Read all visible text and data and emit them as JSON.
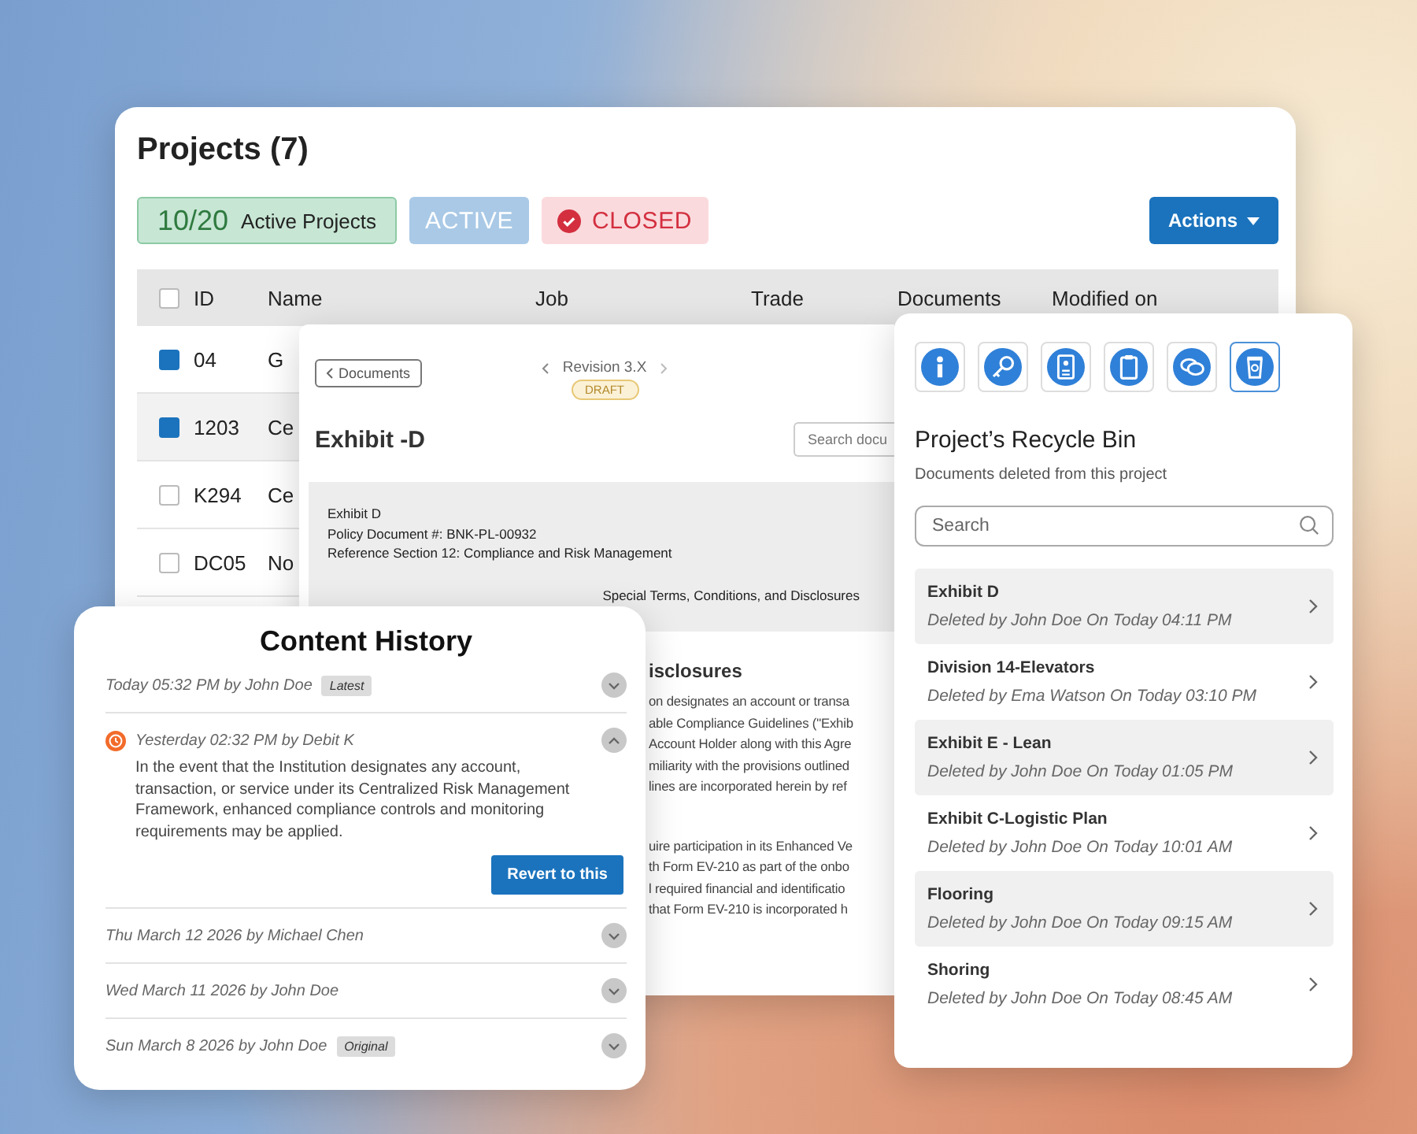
{
  "projects": {
    "title": "Projects (7)",
    "summary": {
      "count": "10/20",
      "label": "Active Projects"
    },
    "filters": [
      {
        "label": "ACTIVE",
        "kind": "active",
        "selected": false
      },
      {
        "label": "CLOSED",
        "kind": "closed",
        "selected": true
      }
    ],
    "actions": "Actions",
    "header_checked": false,
    "columns": [
      "ID",
      "Name",
      "Job",
      "Trade",
      "Documents",
      "Modified on"
    ],
    "rows": [
      {
        "id": "04",
        "name": "G",
        "checked": true,
        "hovered": false
      },
      {
        "id": "1203",
        "name": "Ce",
        "checked": true,
        "hovered": true
      },
      {
        "id": "K294",
        "name": "Ce",
        "checked": false,
        "hovered": false
      },
      {
        "id": "DC05",
        "name": "No",
        "checked": false,
        "hovered": false
      }
    ]
  },
  "document": {
    "back": "Documents",
    "revision": "Revision 3.X",
    "status": "DRAFT",
    "title": "Exhibit -D",
    "search": {
      "placeholder": "Search docu"
    },
    "header_lines": [
      "Exhibit D",
      "Policy Document #: BNK-PL-00932",
      "Reference Section 12: Compliance and Risk Management"
    ],
    "section_title": "Special Terms, Conditions, and Disclosures",
    "heading": "isclosures",
    "paragraphs": [
      [
        "on designates an account or transa",
        "able Compliance Guidelines (\"Exhib",
        "Account Holder along with this Agre",
        "miliarity with the provisions outlined",
        "lines are incorporated herein by ref"
      ],
      [
        "uire participation in its Enhanced Ve",
        "th Form EV-210 as part of the onbo",
        "l required financial and identificatio",
        "that Form EV-210 is incorporated h"
      ]
    ]
  },
  "recycle_bin": {
    "tools": [
      {
        "kind": "info",
        "selected": false
      },
      {
        "kind": "key",
        "selected": false
      },
      {
        "kind": "id-card",
        "selected": false
      },
      {
        "kind": "clipboard",
        "selected": false
      },
      {
        "kind": "chat",
        "selected": false
      },
      {
        "kind": "recycle",
        "selected": true
      }
    ],
    "title": "Project’s Recycle Bin",
    "subtitle": "Documents deleted from this project",
    "search": {
      "placeholder": "Search"
    },
    "items": [
      {
        "name": "Exhibit D",
        "detail": "Deleted by John Doe On Today 04:11 PM"
      },
      {
        "name": "Division 14-Elevators",
        "detail": "Deleted by Ema Watson On Today 03:10 PM"
      },
      {
        "name": "Exhibit E - Lean",
        "detail": "Deleted by John Doe On Today 01:05 PM"
      },
      {
        "name": "Exhibit C-Logistic Plan",
        "detail": "Deleted by John Doe On Today 10:01 AM"
      },
      {
        "name": "Flooring",
        "detail": "Deleted by John Doe On Today 09:15 AM"
      },
      {
        "name": "Shoring",
        "detail": "Deleted by John Doe On Today 08:45 AM"
      }
    ]
  },
  "content_history": {
    "title": "Content History",
    "entries": [
      {
        "meta": "Today 05:32 PM by John Doe",
        "tag": "Latest",
        "expanded": false
      },
      {
        "meta": "Yesterday 02:32 PM by Debit K",
        "expanded": true,
        "body": "In the event that the Institution designates any account, transaction, or service under its Centralized Risk Management Framework, enhanced compliance controls and monitoring requirements may be applied.",
        "action": "Revert to this"
      },
      {
        "meta": "Thu March 12 2026 by Michael Chen",
        "expanded": false
      },
      {
        "meta": "Wed March 11 2026 by John Doe",
        "expanded": false
      },
      {
        "meta": "Sun March 8 2026 by John Doe",
        "tag": "Original",
        "expanded": false
      }
    ]
  }
}
